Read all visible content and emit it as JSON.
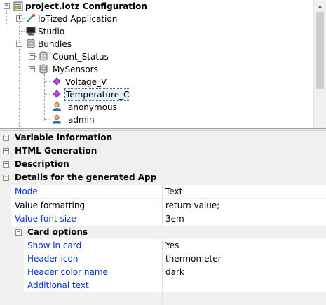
{
  "tree": {
    "nodes": [
      {
        "label": "project.iotz Configuration",
        "bold": true,
        "icon": "project-config-icon",
        "expander": "−"
      },
      {
        "label": "IoTized Application",
        "icon": "iotized-app-icon",
        "expander": "+"
      },
      {
        "label": "Studio",
        "icon": "monitor-icon",
        "expander": ""
      },
      {
        "label": "Bundles",
        "icon": "database-icon",
        "expander": "−"
      },
      {
        "label": "Count_Status",
        "icon": "database-icon",
        "expander": "+"
      },
      {
        "label": "MySensors",
        "icon": "database-icon",
        "expander": "−"
      },
      {
        "label": "Voltage_V",
        "icon": "diamond-icon",
        "expander": ""
      },
      {
        "label": "Temperature_C",
        "icon": "diamond-icon",
        "expander": "",
        "selected": true
      },
      {
        "label": "anonymous",
        "icon": "user-icon",
        "expander": ""
      },
      {
        "label": "admin",
        "icon": "user-icon",
        "expander": ""
      }
    ]
  },
  "grid": {
    "categories": [
      {
        "label": "Variable information",
        "expander": "+"
      },
      {
        "label": "HTML Generation",
        "expander": "+"
      },
      {
        "label": "Description",
        "expander": "+"
      },
      {
        "label": "Details for the generated App",
        "expander": "−"
      }
    ],
    "properties": [
      {
        "name": "Mode",
        "value": "Text",
        "blue": true
      },
      {
        "name": "Value formatting",
        "value": "return value;",
        "blue": false
      },
      {
        "name": "Value font size",
        "value": "3em",
        "blue": true
      }
    ],
    "subcategory": {
      "label": "Card options",
      "expander": "−"
    },
    "subproperties": [
      {
        "name": "Show in card",
        "value": "Yes",
        "blue": true
      },
      {
        "name": "Header icon",
        "value": "thermometer",
        "blue": true
      },
      {
        "name": "Header color name",
        "value": "dark",
        "blue": true
      },
      {
        "name": "Additional text",
        "value": "",
        "blue": true
      }
    ]
  }
}
